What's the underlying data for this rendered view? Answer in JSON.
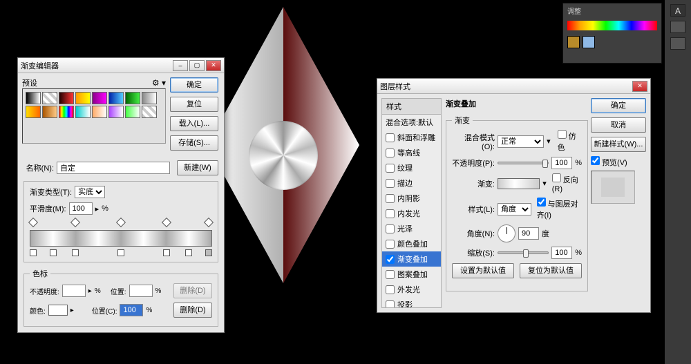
{
  "canvas": {
    "disc_label": "shine-disc"
  },
  "grad": {
    "title": "渐变编辑器",
    "presets_label": "预设",
    "ok": "确定",
    "reset": "复位",
    "load": "载入(L)...",
    "save": "存储(S)...",
    "name_label": "名称(N):",
    "name_value": "自定",
    "new_btn": "新建(W)",
    "type_label": "渐变类型(T):",
    "type_value": "实底",
    "smooth_label": "平滑度(M):",
    "smooth_value": "100",
    "percent": "%",
    "stops_label": "色标",
    "opacity_label": "不透明度:",
    "opacity_val": "",
    "pos1_label": "位置:",
    "pos1_val": "",
    "delete1": "删除(D)",
    "color_label": "颜色:",
    "pos2_label": "位置(C):",
    "pos2_val": "100",
    "delete2": "删除(D)",
    "swatches": [
      "linear-gradient(90deg,#000,#fff)",
      "repeating-linear-gradient(45deg,#ccc 0 4px,#fff 4px 8px)",
      "linear-gradient(90deg,#200,#f33)",
      "linear-gradient(90deg,#f90,#ff0)",
      "linear-gradient(90deg,#808,#f0f)",
      "linear-gradient(90deg,#02a,#5cf)",
      "linear-gradient(90deg,#060,#4e4)",
      "linear-gradient(90deg,#888,#fff)",
      "linear-gradient(90deg,#fd0,#f60)",
      "linear-gradient(90deg,#a50,#fc8)",
      "linear-gradient(90deg,#f00,#ff0,#0f0,#0ff,#00f,#f0f,#f00)",
      "linear-gradient(90deg,#0cc,#fff)",
      "linear-gradient(90deg,#fa6,#fff)",
      "linear-gradient(90deg,#a4f,#fff)",
      "linear-gradient(90deg,#4f4,#fff)",
      "repeating-linear-gradient(45deg,#ccc 0 4px,#fff 4px 8px)"
    ]
  },
  "ls": {
    "title": "图层样式",
    "list_header": "样式",
    "items": [
      {
        "label": "混合选项:默认",
        "chk": false,
        "nochk": true
      },
      {
        "label": "斜面和浮雕",
        "chk": false
      },
      {
        "label": "等高线",
        "chk": false
      },
      {
        "label": "纹理",
        "chk": false
      },
      {
        "label": "描边",
        "chk": false
      },
      {
        "label": "内阴影",
        "chk": false
      },
      {
        "label": "内发光",
        "chk": false
      },
      {
        "label": "光泽",
        "chk": false
      },
      {
        "label": "颜色叠加",
        "chk": false
      },
      {
        "label": "渐变叠加",
        "chk": true,
        "sel": true
      },
      {
        "label": "图案叠加",
        "chk": false
      },
      {
        "label": "外发光",
        "chk": false
      },
      {
        "label": "投影",
        "chk": false
      }
    ],
    "section_title": "渐变叠加",
    "sub_title": "渐变",
    "blend_label": "混合模式(O):",
    "blend_value": "正常",
    "dither_label": "仿色",
    "opacity_label": "不透明度(P):",
    "opacity_value": "100",
    "percent": "%",
    "grad_label": "渐变:",
    "reverse_label": "反向(R)",
    "style_label": "样式(L):",
    "style_value": "角度",
    "align_label": "与图层对齐(I)",
    "angle_label": "角度(N):",
    "angle_value": "90",
    "angle_unit": "度",
    "scale_label": "缩放(S):",
    "scale_value": "100",
    "set_default": "设置为默认值",
    "reset_default": "复位为默认值",
    "ok": "确定",
    "cancel": "取消",
    "new_style": "新建样式(W)...",
    "preview_label": "预览(V)"
  },
  "panel": {
    "tab1": "调整"
  }
}
